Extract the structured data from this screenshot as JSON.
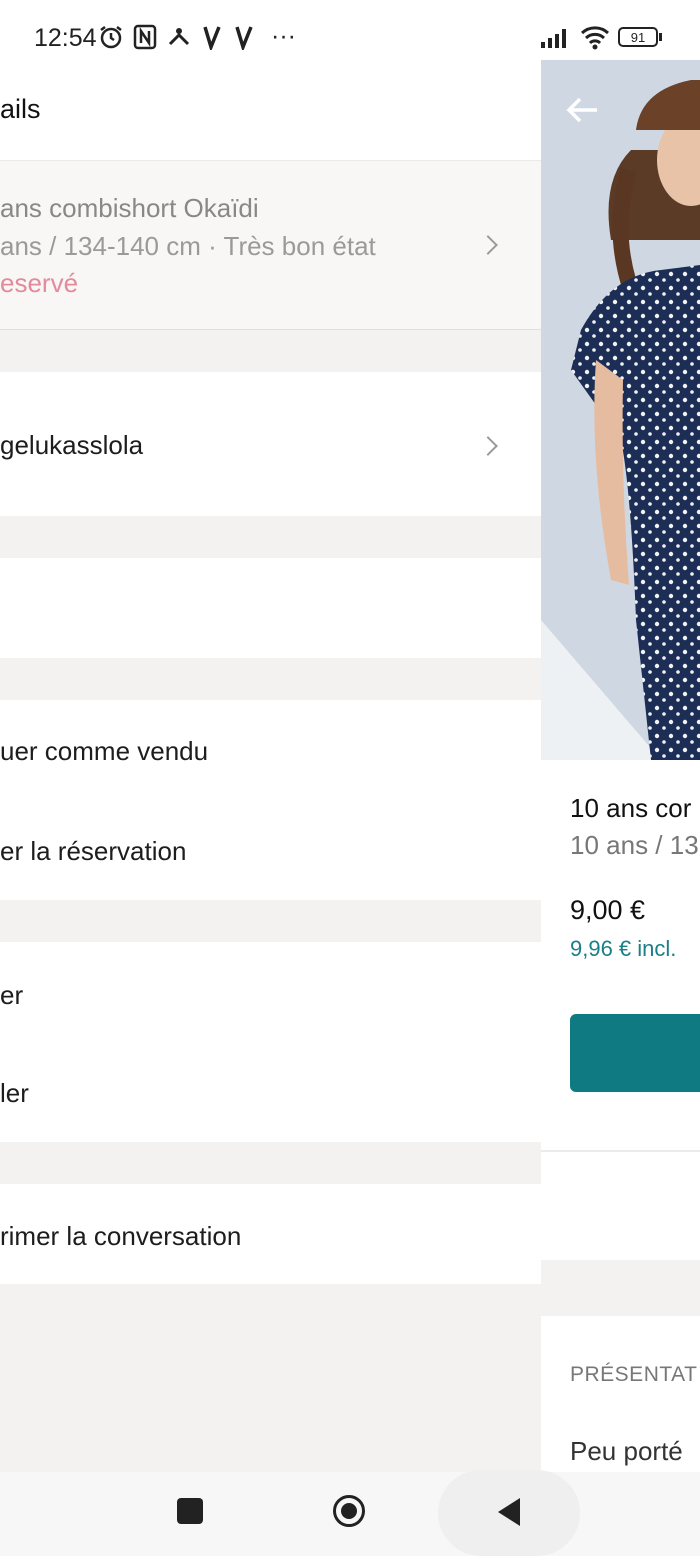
{
  "status_bar": {
    "time": "12:54",
    "more": "···",
    "battery": "91",
    "icons": [
      "alarm-icon",
      "nfc-icon",
      "notification-icon",
      "v-app-icon",
      "v-app-icon",
      "signal-icon",
      "wifi-icon",
      "battery-icon"
    ]
  },
  "details_panel": {
    "title": "ails",
    "item": {
      "title": "ans combishort Okaïdi",
      "meta": "ans / 134-140 cm · Très bon état",
      "status": "eservé",
      "status_color": "#e38a9b"
    },
    "user": {
      "name": "gelukasslola"
    },
    "actions_group1": [
      {
        "label": "uer comme vendu"
      },
      {
        "label": "er la réservation"
      }
    ],
    "actions_group2": [
      {
        "label": "er"
      },
      {
        "label": "ler"
      }
    ],
    "actions_group3": [
      {
        "label": "rimer la conversation"
      }
    ]
  },
  "item_panel": {
    "title": "10 ans cor",
    "subtitle": "10 ans / 13",
    "price": "9,00 €",
    "price_incl": "9,96 € incl.",
    "section_heading": "PRÉSENTAT",
    "description": "Peu porté",
    "accent_color": "#0f7a82"
  },
  "nav_bar": {
    "buttons": [
      "recent-apps",
      "home",
      "back"
    ]
  }
}
